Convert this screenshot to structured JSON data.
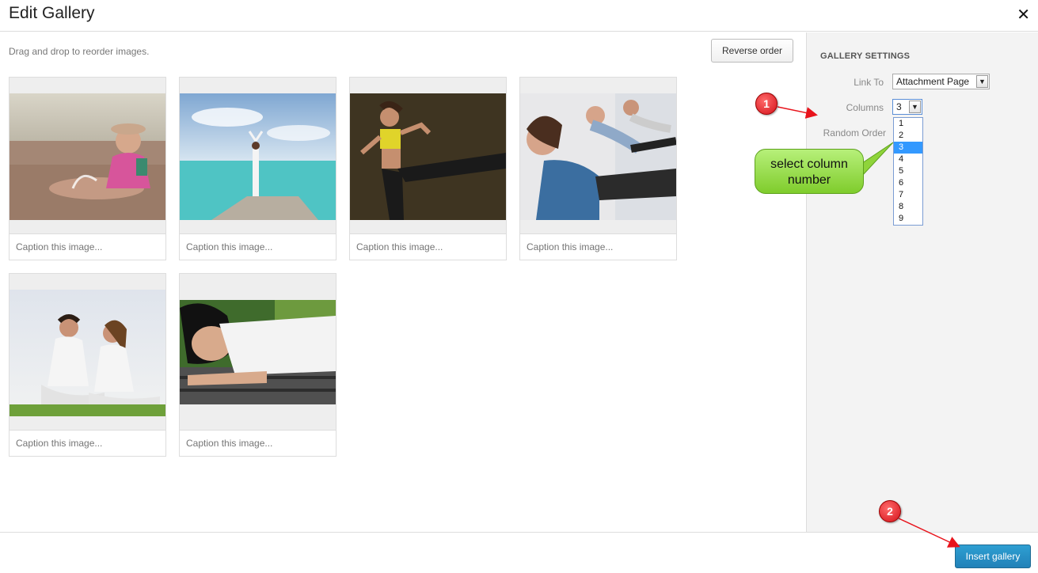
{
  "header": {
    "title": "Edit Gallery",
    "close_glyph": "✕"
  },
  "main": {
    "instructions": "Drag and drop to reorder images.",
    "reverse_label": "Reverse order",
    "thumbnails": [
      {
        "caption_placeholder": "Caption this image...",
        "subject": "child-at-beach"
      },
      {
        "caption_placeholder": "Caption this image...",
        "subject": "yoga-on-pier"
      },
      {
        "caption_placeholder": "Caption this image...",
        "subject": "kickboxing-woman"
      },
      {
        "caption_placeholder": "Caption this image...",
        "subject": "fitness-class"
      },
      {
        "caption_placeholder": "Caption this image...",
        "subject": "couple-meditating"
      },
      {
        "caption_placeholder": "Caption this image...",
        "subject": "woman-sleeping"
      }
    ]
  },
  "sidebar": {
    "heading": "GALLERY SETTINGS",
    "link_to_label": "Link To",
    "link_to_value": "Attachment Page",
    "columns_label": "Columns",
    "columns_value": "3",
    "random_order_label": "Random Order",
    "column_options": [
      "1",
      "2",
      "3",
      "4",
      "5",
      "6",
      "7",
      "8",
      "9"
    ],
    "selected_option": "3"
  },
  "footer": {
    "insert_label": "Insert gallery"
  },
  "annotations": {
    "marker_1": "1",
    "marker_2": "2",
    "callout_line1": "select column",
    "callout_line2": "number"
  },
  "colors": {
    "accent": "#2181b8",
    "marker": "#d4111a",
    "callout": "#8fd43a",
    "selection": "#3399ff"
  }
}
